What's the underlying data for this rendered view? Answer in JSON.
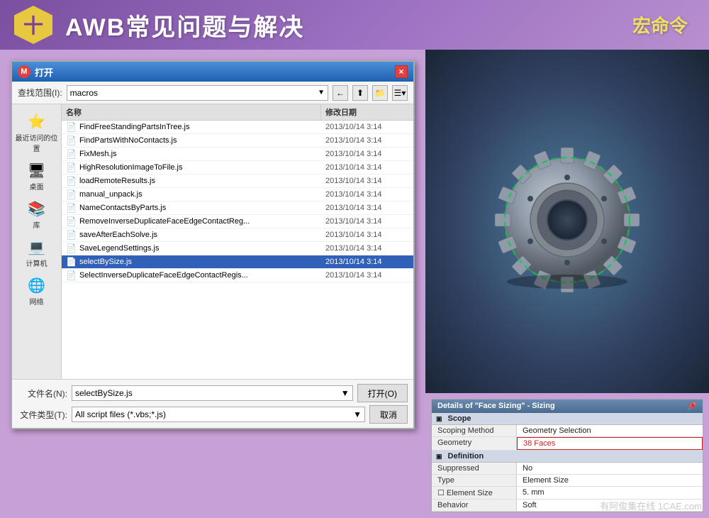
{
  "header": {
    "hex_symbol": "十",
    "title": "AWB常见问题与解决",
    "subtitle": "宏命令"
  },
  "dialog": {
    "title": "打开",
    "close_btn": "×",
    "toolbar": {
      "label": "查找范围(I):",
      "folder": "macros",
      "back_btn": "←",
      "up_btn": "↑",
      "new_btn": "📁",
      "view_btn": "☰"
    },
    "columns": {
      "name": "名称",
      "date": "修改日期"
    },
    "files": [
      {
        "name": "FindFreeStandingPartsInTree.js",
        "date": "2013/10/14 3:14"
      },
      {
        "name": "FindPartsWithNoContacts.js",
        "date": "2013/10/14 3:14"
      },
      {
        "name": "FixMesh.js",
        "date": "2013/10/14 3:14"
      },
      {
        "name": "HighResolutionImageToFile.js",
        "date": "2013/10/14 3:14"
      },
      {
        "name": "loadRemoteResults.js",
        "date": "2013/10/14 3:14"
      },
      {
        "name": "manual_unpack.js",
        "date": "2013/10/14 3:14"
      },
      {
        "name": "NameContactsByParts.js",
        "date": "2013/10/14 3:14"
      },
      {
        "name": "RemoveInverseDuplicateFaceEdgeContactReg...",
        "date": "2013/10/14 3:14"
      },
      {
        "name": "saveAfterEachSolve.js",
        "date": "2013/10/14 3:14"
      },
      {
        "name": "SaveLegendSettings.js",
        "date": "2013/10/14 3:14"
      },
      {
        "name": "selectBySize.js",
        "date": "2013/10/14 3:14",
        "selected": true
      },
      {
        "name": "SelectInverseDuplicateFaceEdgeContactRegis...",
        "date": "2013/10/14 3:14"
      }
    ],
    "filename_label": "文件名(N):",
    "filetype_label": "文件类型(T):",
    "filename_value": "selectBySize.js",
    "filetype_value": "All script files (*.vbs;*.js)",
    "open_btn": "打开(O)",
    "cancel_btn": "取消"
  },
  "sidebar": {
    "items": [
      {
        "icon": "⭐",
        "label": "最近访问的位置"
      },
      {
        "icon": "🖥",
        "label": "桌面"
      },
      {
        "icon": "📚",
        "label": "库"
      },
      {
        "icon": "💻",
        "label": "计算机"
      },
      {
        "icon": "🌐",
        "label": "网络"
      }
    ]
  },
  "details": {
    "title": "Details of \"Face Sizing\" - Sizing",
    "sections": [
      {
        "name": "Scope",
        "rows": [
          {
            "key": "Scoping Method",
            "value": "Geometry Selection",
            "highlight": false
          },
          {
            "key": "Geometry",
            "value": "38 Faces",
            "highlight": true
          }
        ]
      },
      {
        "name": "Definition",
        "rows": [
          {
            "key": "Suppressed",
            "value": "No",
            "highlight": false
          },
          {
            "key": "Type",
            "value": "Element Size",
            "highlight": false
          },
          {
            "key": "Element Size",
            "value": "5. mm",
            "highlight": false
          },
          {
            "key": "Behavior",
            "value": "Soft",
            "highlight": false
          }
        ]
      }
    ]
  },
  "watermark": "有阿俊集在线 1CAE.com"
}
